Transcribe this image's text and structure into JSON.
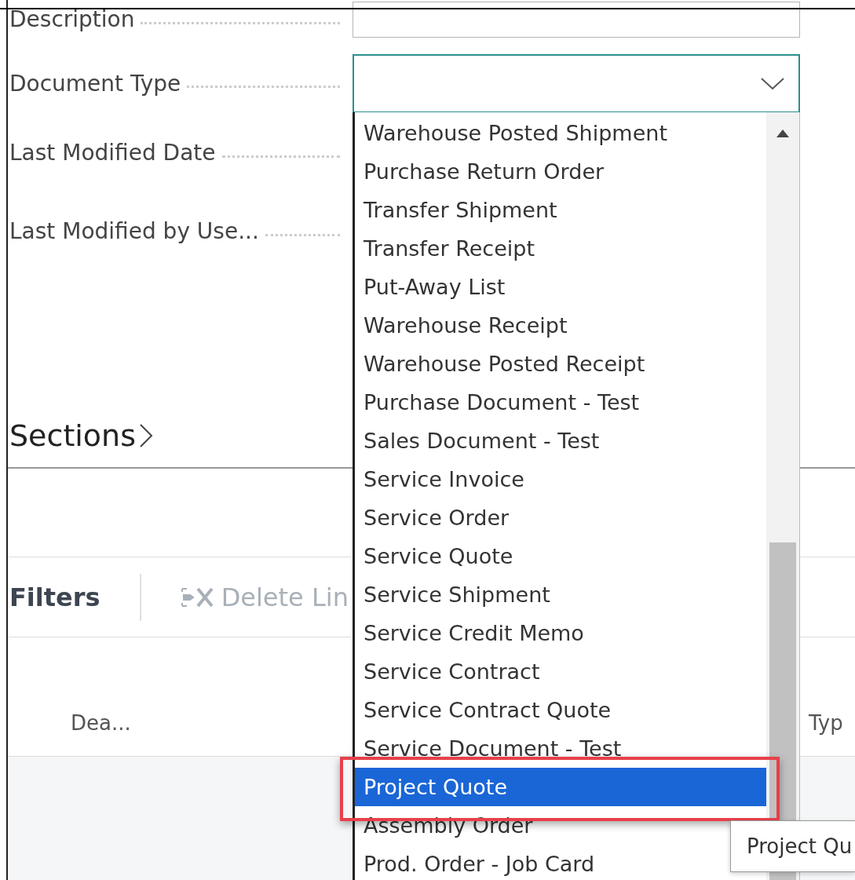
{
  "fields": [
    {
      "label": "Description",
      "kind": "text"
    },
    {
      "label": "Document Type",
      "kind": "select"
    },
    {
      "label": "Last Modified Date",
      "kind": "hidden"
    },
    {
      "label": "Last Modified by Use...",
      "kind": "hidden"
    }
  ],
  "sections_title": "Sections",
  "toolbar": {
    "title": "Filters",
    "actions": [
      {
        "label": "Delete Lin",
        "disabled": true
      }
    ]
  },
  "table": {
    "columns": [
      "Dea...",
      "Typ"
    ]
  },
  "dropdown": {
    "items": [
      {
        "label": "Warehouse Posted Shipment",
        "selected": false
      },
      {
        "label": "Purchase Return Order",
        "selected": false
      },
      {
        "label": "Transfer Shipment",
        "selected": false
      },
      {
        "label": "Transfer Receipt",
        "selected": false
      },
      {
        "label": "Put-Away List",
        "selected": false
      },
      {
        "label": "Warehouse Receipt",
        "selected": false
      },
      {
        "label": "Warehouse Posted Receipt",
        "selected": false
      },
      {
        "label": "Purchase Document - Test",
        "selected": false
      },
      {
        "label": "Sales Document - Test",
        "selected": false
      },
      {
        "label": "Service Invoice",
        "selected": false
      },
      {
        "label": "Service Order",
        "selected": false
      },
      {
        "label": "Service Quote",
        "selected": false
      },
      {
        "label": "Service Shipment",
        "selected": false
      },
      {
        "label": "Service Credit Memo",
        "selected": false
      },
      {
        "label": "Service Contract",
        "selected": false
      },
      {
        "label": "Service Contract Quote",
        "selected": false
      },
      {
        "label": "Service Document - Test",
        "selected": false
      },
      {
        "label": "Project Quote",
        "selected": true
      },
      {
        "label": "Assembly Order",
        "selected": false
      },
      {
        "label": "Prod. Order - Job Card",
        "selected": false
      }
    ]
  },
  "tooltip": "Project Qu"
}
